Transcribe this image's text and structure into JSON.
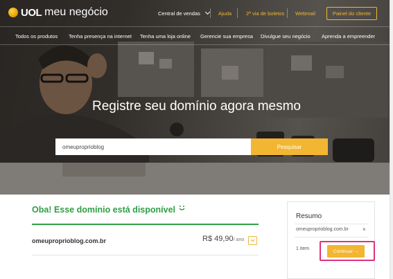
{
  "brand": {
    "uol": "UOL",
    "product": "meu negócio"
  },
  "top_nav": {
    "central": "Central de vendas",
    "ajuda": "Ajuda",
    "boletos": "2ª via de boletos",
    "webmail": "Webmail",
    "painel": "Painel do cliente"
  },
  "secondary_nav": [
    "Todos os produtos",
    "Tenha presença na internet",
    "Tenha uma loja online",
    "Gerencie sua empresa",
    "Divulgue seu negócio",
    "Aprenda a empreender"
  ],
  "hero": {
    "headline": "Registre seu domínio agora mesmo",
    "search_value": "omeuproprioblog",
    "search_button": "Pesquisar"
  },
  "result": {
    "title": "Oba! Esse domínio está disponível",
    "domain": "omeuproprioblog.com.br",
    "price": "R$ 49,90",
    "period": "/ ano"
  },
  "summary": {
    "title": "Resumo",
    "item": "omeuproprioblog.com.br",
    "count": "1 item",
    "continue": "Continuar"
  },
  "colors": {
    "accent": "#f2b632",
    "success": "#2f9e45",
    "highlight": "#e0307a"
  },
  "icons": [
    "uol-logo-icon",
    "chevron-down-icon",
    "smile-icon",
    "checkbox-icon",
    "close-icon",
    "arrow-right-icon"
  ]
}
